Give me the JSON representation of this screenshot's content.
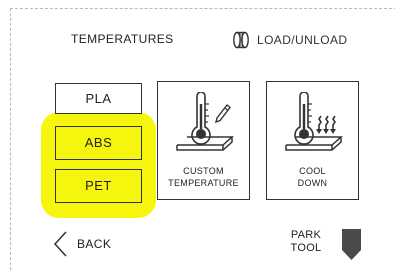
{
  "header": {
    "tabs": [
      {
        "label": "TEMPERATURES",
        "active": true
      },
      {
        "label": "LOAD/UNLOAD",
        "icon": "filament-spool-icon",
        "active": false
      }
    ]
  },
  "presets": [
    {
      "label": "PLA",
      "highlighted": false
    },
    {
      "label": "ABS",
      "highlighted": true
    },
    {
      "label": "PET",
      "highlighted": true
    }
  ],
  "tiles": [
    {
      "line1": "CUSTOM",
      "line2": "TEMPERATURE",
      "icon": "thermometer-pencil-icon"
    },
    {
      "line1": "COOL",
      "line2": "DOWN",
      "icon": "thermometer-cooling-icon"
    }
  ],
  "footer": {
    "back_label": "BACK",
    "back_icon": "chevron-left-icon",
    "park_line1": "PARK",
    "park_line2": "TOOL",
    "park_icon": "park-arrow-down-icon"
  },
  "colors": {
    "highlight": "#f5f50d",
    "border": "#333333",
    "dashed_outline": "#b8b8b8"
  }
}
